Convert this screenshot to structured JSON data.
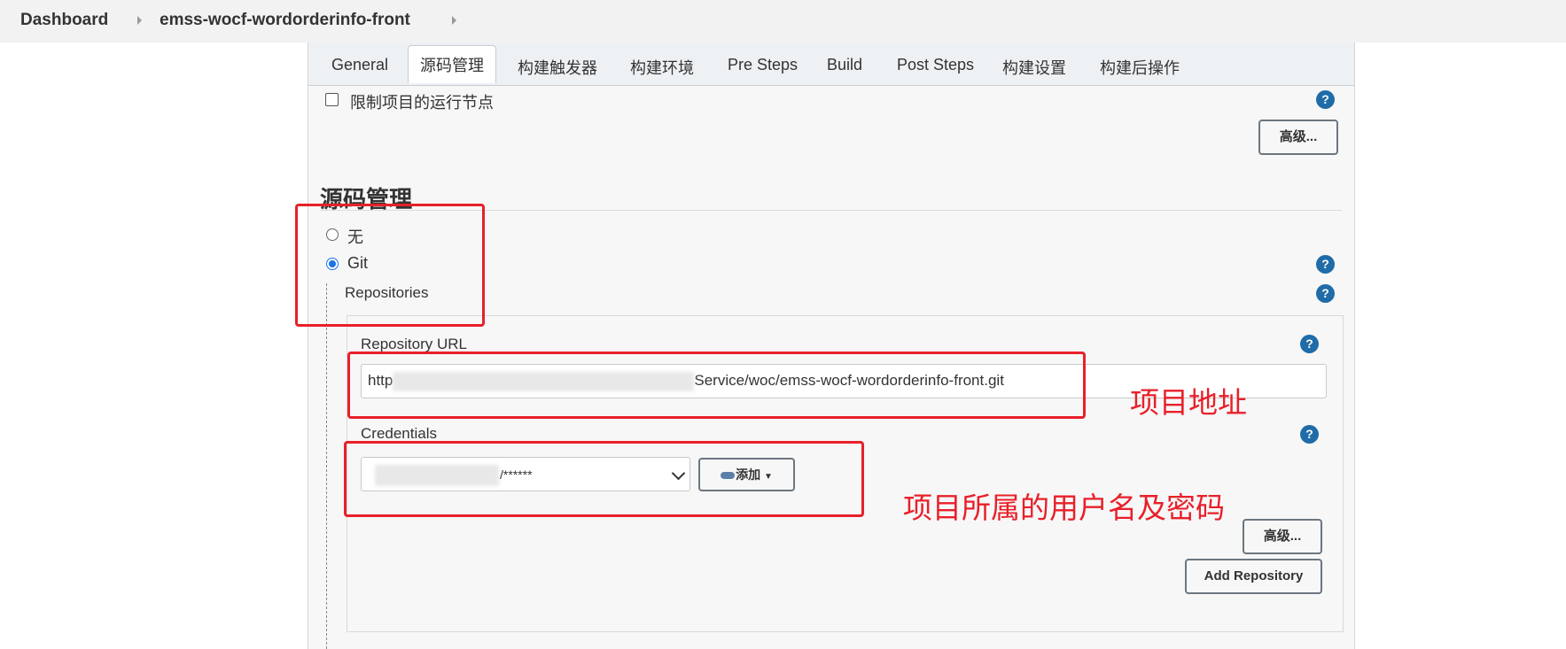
{
  "breadcrumb": {
    "dashboard": "Dashboard",
    "project": "emss-wocf-wordorderinfo-front"
  },
  "tabs": [
    "General",
    "源码管理",
    "构建触发器",
    "构建环境",
    "Pre Steps",
    "Build",
    "Post Steps",
    "构建设置",
    "构建后操作"
  ],
  "active_tab": "源码管理",
  "restrict_label": "限制项目的运行节点",
  "advanced_label": "高级...",
  "scm": {
    "title": "源码管理",
    "option_none": "无",
    "option_git": "Git",
    "selected": "Git",
    "repositories_label": "Repositories",
    "repo_url_label": "Repository URL",
    "repo_url_prefix": "http",
    "repo_url_suffix": "Service/woc/emss-wocf-wordorderinfo-front.git",
    "credentials_label": "Credentials",
    "credentials_masked": "/******",
    "add_label": "添加",
    "advanced_label": "高级...",
    "add_repository_label": "Add Repository"
  },
  "annotations": {
    "project_address": "项目地址",
    "user_password": "项目所属的用户名及密码"
  },
  "colors": {
    "annotation_red": "#e8202a",
    "help_blue": "#1f6ca8",
    "radio_blue": "#1a73e8"
  }
}
